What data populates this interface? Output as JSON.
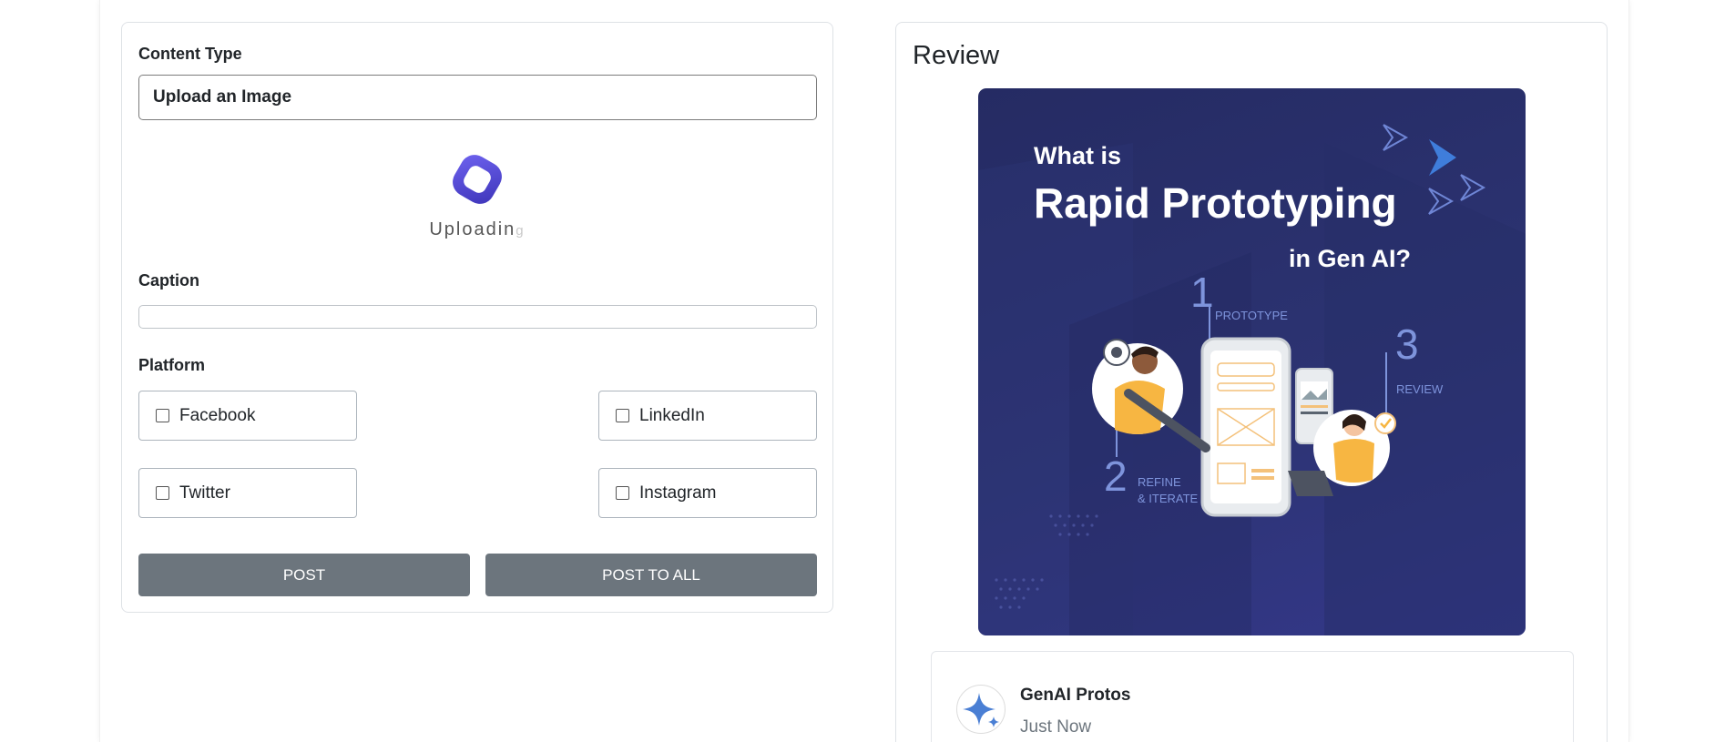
{
  "form": {
    "content_type_label": "Content Type",
    "content_type_value": "Upload an Image",
    "upload_status": "Uploadin",
    "upload_status_faded": "g",
    "caption_label": "Caption",
    "caption_value": "",
    "platform_label": "Platform",
    "platforms": [
      {
        "label": "Facebook",
        "checked": false
      },
      {
        "label": "LinkedIn",
        "checked": false
      },
      {
        "label": "Twitter",
        "checked": false
      },
      {
        "label": "Instagram",
        "checked": false
      }
    ],
    "post_button": "POST",
    "post_all_button": "POST TO ALL"
  },
  "review": {
    "title": "Review",
    "poster": {
      "line1": "What is",
      "line2": "Rapid Prototyping",
      "line3": "in Gen AI?",
      "step1_num": "1",
      "step1_label": "PROTOTYPE",
      "step2_num": "2",
      "step2_label_a": "REFINE",
      "step2_label_b": "& ITERATE",
      "step3_num": "3",
      "step3_label": "REVIEW"
    },
    "post": {
      "author": "GenAI Protos",
      "time": "Just Now"
    }
  },
  "colors": {
    "button_bg": "#6c757d",
    "poster_bg": "#2a3170",
    "brand_purple": "#5b4fd6",
    "avatar_star": "#4a7fd4"
  }
}
